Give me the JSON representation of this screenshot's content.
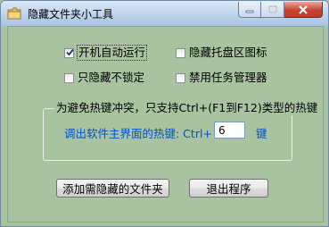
{
  "window": {
    "title": "隐藏文件夹小工具",
    "controls": {
      "minimize": "minimize",
      "maximize": "maximize",
      "close": "close"
    }
  },
  "options": [
    {
      "label": "开机自动运行",
      "checked": true
    },
    {
      "label": "隐藏托盘区图标",
      "checked": false
    },
    {
      "label": "只隐藏不锁定",
      "checked": false
    },
    {
      "label": "禁用任务管理器",
      "checked": false
    }
  ],
  "hotkey_group": {
    "title": "为避免热键冲突，只支持Ctrl+(F1到F12)类型的热键",
    "label": "调出软件主界面的热键: Ctrl+ F",
    "value": "6",
    "suffix": "键"
  },
  "buttons": {
    "add_folder": "添加需隐藏的文件夹",
    "exit": "退出程序"
  },
  "colors": {
    "background": "#a9c3a0",
    "hotkey_text": "#0050c8",
    "close_button": "#c7432e"
  }
}
